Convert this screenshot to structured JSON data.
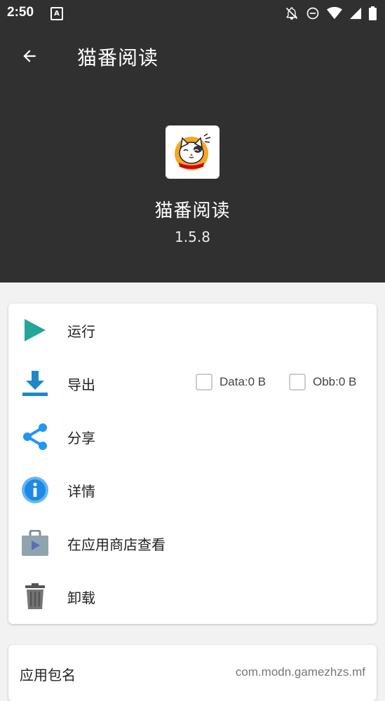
{
  "status_bar": {
    "time": "2:50",
    "notification_badge": "A",
    "icons": [
      "notifications-off-icon",
      "do-not-disturb-icon",
      "wifi-icon",
      "signal-icon",
      "battery-icon"
    ]
  },
  "app_bar": {
    "back_icon": "arrow-left-icon",
    "title": "猫番阅读"
  },
  "app_info": {
    "name": "猫番阅读",
    "version": "1.5.8"
  },
  "actions": [
    {
      "label": "运行",
      "icon": "play-icon",
      "color": "#26a69a"
    },
    {
      "label": "导出",
      "icon": "download-icon",
      "color": "#1e88c8"
    },
    {
      "label": "分享",
      "icon": "share-icon",
      "color": "#2196f3"
    },
    {
      "label": "详情",
      "icon": "info-icon",
      "color": "#2196f3"
    },
    {
      "label": "在应用商店查看",
      "icon": "store-icon",
      "color": "#90a4ae"
    },
    {
      "label": "卸载",
      "icon": "trash-icon",
      "color": "#616161"
    }
  ],
  "export_options": {
    "data_label": "Data:0 B",
    "obb_label": "Obb:0 B"
  },
  "package_info": {
    "label": "应用包名",
    "value": "com.modn.gamezhzs.mf"
  },
  "colors": {
    "header_bg": "#303030",
    "page_bg": "#f2f2f2",
    "card_bg": "#ffffff"
  }
}
